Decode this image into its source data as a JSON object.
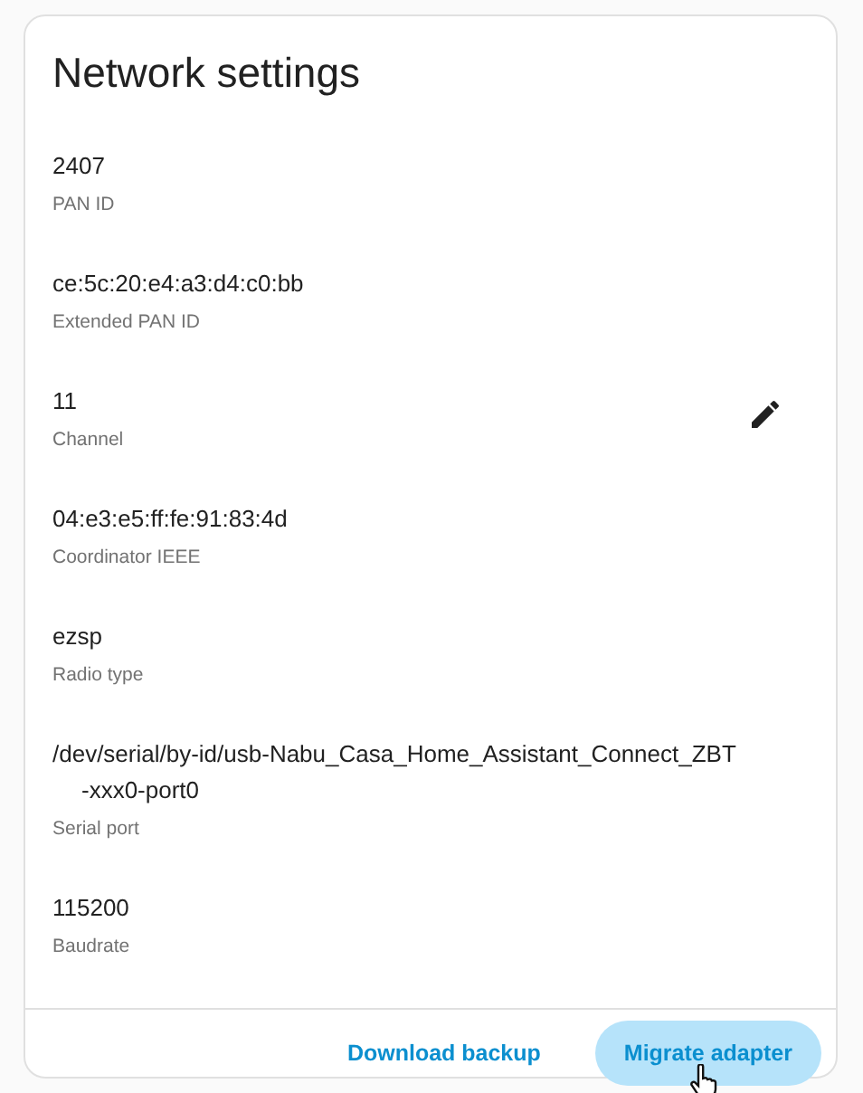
{
  "card": {
    "title": "Network settings",
    "items": [
      {
        "value": "2407",
        "label": "PAN ID",
        "editable": false
      },
      {
        "value": "ce:5c:20:e4:a3:d4:c0:bb",
        "label": "Extended PAN ID",
        "editable": false
      },
      {
        "value": "11",
        "label": "Channel",
        "editable": true
      },
      {
        "value": "04:e3:e5:ff:fe:91:83:4d",
        "label": "Coordinator IEEE",
        "editable": false
      },
      {
        "value": "ezsp",
        "label": "Radio type",
        "editable": false
      },
      {
        "value": "/dev/serial/by-id/usb-Nabu_Casa_Home_Assistant_Connect_ZBT-xxx0-port0",
        "label": "Serial port",
        "editable": false
      },
      {
        "value": "115200",
        "label": "Baudrate",
        "editable": false
      }
    ],
    "actions": [
      {
        "label": "Download backup",
        "hovered": false
      },
      {
        "label": "Migrate adapter",
        "hovered": true
      }
    ]
  }
}
